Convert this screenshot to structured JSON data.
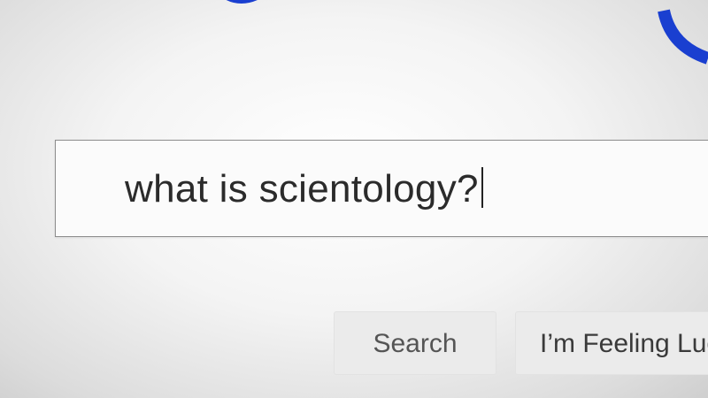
{
  "search": {
    "query": "what is scientology?"
  },
  "buttons": {
    "search_label": "Search",
    "lucky_label": "I’m Feeling Luc"
  },
  "colors": {
    "logo_blue": "#1a3fd0",
    "button_bg": "#ebebeb",
    "input_border": "#8c8c8c"
  }
}
